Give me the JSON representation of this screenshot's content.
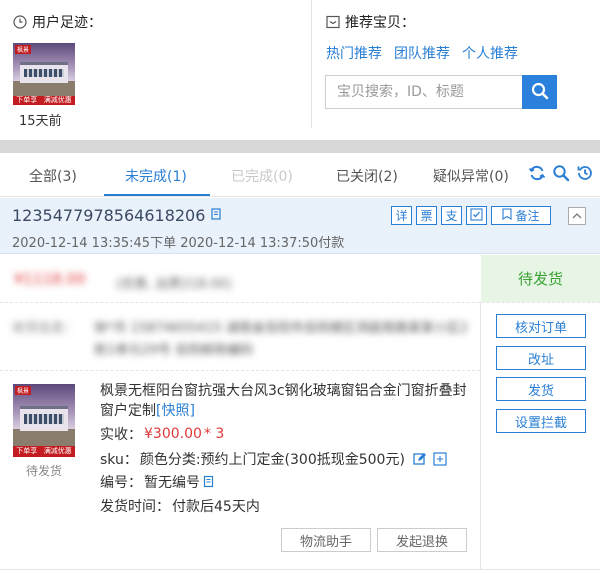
{
  "footprint": {
    "title": "用户足迹：",
    "time_ago": "15天前"
  },
  "recommend": {
    "title": "推荐宝贝：",
    "links": [
      "热门推荐",
      "团队推荐",
      "个人推荐"
    ],
    "search_placeholder": "宝贝搜索，ID、标题"
  },
  "tabs": [
    {
      "label": "全部(3)"
    },
    {
      "label": "未完成(1)"
    },
    {
      "label": "已完成(0)"
    },
    {
      "label": "已关闭(2)"
    },
    {
      "label": "疑似异常(0)"
    }
  ],
  "order": {
    "id": "1235477978564618206",
    "times": "2020-12-14 13:35:45下单 2020-12-14 13:37:50付款",
    "header_buttons": [
      "详",
      "票",
      "支",
      "备注"
    ],
    "price_blurred": "¥1118.00",
    "price_sub_blurred": "(优惠, 运费218.00)",
    "status": "待发货",
    "address_label": "收货信息：",
    "address_blurred": "徐*月 15874655415 湖南省岳阳市岳阳楼区洞庭南路某某小区2栋1单元29号 岳阳邮政编码",
    "actions": [
      "核对订单",
      "改址",
      "发货",
      "设置拦截"
    ]
  },
  "item": {
    "title": "枫景无框阳台窗抗强大台风3c钢化玻璃窗铝合金门窗折叠封窗户定制",
    "title_fast": "[快照]",
    "status": "待发货",
    "paid_label": "实收：",
    "paid_value": "¥300.00",
    "qty": "* 3",
    "sku_label": "sku：",
    "sku_value": "颜色分类:预约上门定金(300抵现金500元)",
    "code_label": "编号：",
    "code_value": "暂无编号",
    "ship_label": "发货时间：",
    "ship_value": "付款后45天内",
    "buttons": [
      "物流助手",
      "发起退换"
    ]
  },
  "thumb_texts": {
    "left": "下单享",
    "right": "满减优惠",
    "tag": "枫景"
  }
}
